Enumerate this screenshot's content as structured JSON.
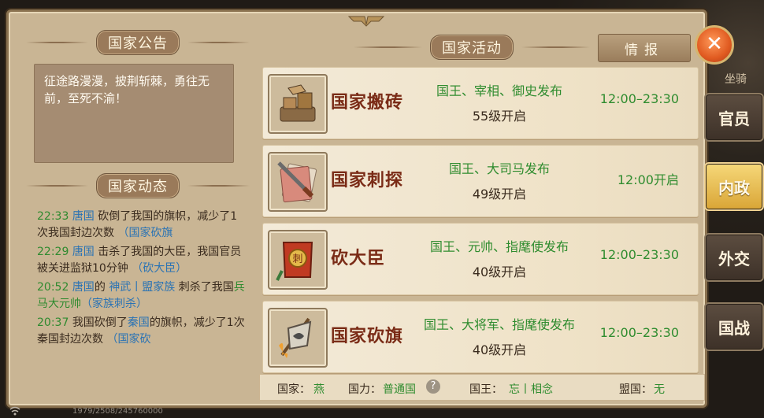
{
  "announcement": {
    "title": "国家公告",
    "text": "征途路漫漫，披荆斩棘，勇往无前，至死不渝！"
  },
  "feed": {
    "title": "国家动态",
    "entries": [
      {
        "time": "22:33",
        "pre": "",
        "country": "唐国",
        "text": "砍倒了我国的旗帜，减少了1次我国封边次数",
        "tag": "（国家砍旗"
      },
      {
        "time": "22:29",
        "pre": "",
        "country": "唐国",
        "text": "击杀了我国的大臣，我国官员被关进监狱10分钟",
        "tag": "（砍大臣）"
      },
      {
        "time": "20:52",
        "pre": "",
        "country": "唐国",
        "mid": "的",
        "league": "神武丨盟家族",
        "text2": "刺杀了我国",
        "rank": "兵马大元帅",
        "tag": "（家族刺杀）"
      },
      {
        "time": "20:37",
        "pre": "我国砍倒了",
        "country": "秦国",
        "text": "的旗帜，减少了1次秦国封边次数",
        "tag": "（国家砍"
      }
    ]
  },
  "activities": {
    "title": "国家活动",
    "intel_tab": "情报",
    "items": [
      {
        "name": "国家搬砖",
        "publishers": "国王、宰相、御史发布",
        "level": "55级开启",
        "time": "12:00–23:30",
        "icon": "bricks-icon"
      },
      {
        "name": "国家刺探",
        "publishers": "国王、大司马发布",
        "level": "49级开启",
        "time": "12:00开启",
        "icon": "scout-sword-icon"
      },
      {
        "name": "砍大臣",
        "publishers": "国王、元帅、指麾使发布",
        "level": "40级开启",
        "time": "12:00–23:30",
        "icon": "minister-scroll-icon"
      },
      {
        "name": "国家砍旗",
        "publishers": "国王、大将军、指麾使发布",
        "level": "40级开启",
        "time": "12:00–23:30",
        "icon": "flag-icon"
      }
    ]
  },
  "status": {
    "country_label": "国家：",
    "country": "燕",
    "power_label": "国力：",
    "power": "普通国",
    "king_label": "国王：",
    "king": "忘丨相念",
    "alliance_label": "盟国：",
    "alliance": "无"
  },
  "side_nav": {
    "close": "✕",
    "items": [
      {
        "label": "官员",
        "active": false
      },
      {
        "label": "内政",
        "active": true
      },
      {
        "label": "外交",
        "active": false
      },
      {
        "label": "国战",
        "active": false
      }
    ],
    "deco_top": "坐骑"
  },
  "footer": {
    "text": "1979/2508/245760000"
  },
  "colors": {
    "accent_green": "#2f8c2f",
    "link_blue": "#2a73b4",
    "title_red": "#7a2b16"
  }
}
